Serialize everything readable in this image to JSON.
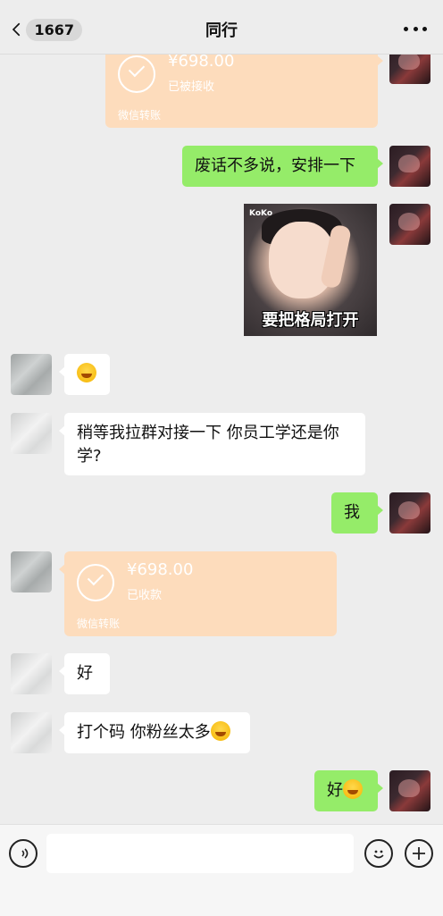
{
  "header": {
    "unread_count": "1667",
    "title": "同行"
  },
  "messages": {
    "transfer_1": {
      "amount": "¥698.00",
      "status": "已被接收",
      "source": "微信转账"
    },
    "msg_1": "废话不多说，安排一下",
    "sticker": {
      "brand": "KoKo",
      "caption": "要把格局打开"
    },
    "msg_3": "稍等我拉群对接一下 你员工学还是你学?",
    "msg_4": "我",
    "transfer_2": {
      "amount": "¥698.00",
      "status": "已收款",
      "source": "微信转账"
    },
    "msg_5": "好",
    "msg_6": "打个码 你粉丝太多",
    "msg_7": "好"
  },
  "colors": {
    "background": "#ededed",
    "green_bubble": "#95ec69",
    "transfer_card": "#fddcbc"
  }
}
